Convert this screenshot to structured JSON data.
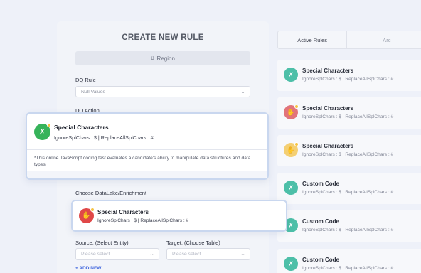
{
  "form": {
    "title": "CREATE NEW RULE",
    "region_label": "Region",
    "dq_rule_label": "DQ Rule",
    "dq_rule_value": "Null Values",
    "dq_action_label": "DQ Action",
    "choose_label": "Choose DataLake/Enrichment",
    "source_label": "Source: (Select Entity)",
    "target_label": "Target: (Choose Table)",
    "source_placeholder": "Please select",
    "target_placeholder": "Please select",
    "add_new_label": "+ ADD NEW"
  },
  "tabs": [
    {
      "label": "Active Rules",
      "active": true
    },
    {
      "label": "Arc",
      "active": false
    }
  ],
  "rules": [
    {
      "name": "Special Characters",
      "params": "IgnoreSplChars : $  |  ReplaceAllSplChars : #",
      "icon": "tools-icon",
      "color": "#4dbfa8",
      "badge": false
    },
    {
      "name": "Special Characters",
      "params": "IgnoreSplChars : $  |  ReplaceAllSplChars : #",
      "icon": "hand-icon",
      "color": "#e2747a",
      "badge": true
    },
    {
      "name": "Special Characters",
      "params": "IgnoreSplChars : $  |  ReplaceAllSplChars : #",
      "icon": "hand-icon",
      "color": "#f4cf72",
      "badge": true
    },
    {
      "name": "Custom Code",
      "params": "IgnoreSplChars : $  |  ReplaceAllSplChars : #",
      "icon": "tools-icon",
      "color": "#4dbfa8",
      "badge": false
    },
    {
      "name": "Custom Code",
      "params": "IgnoreSplChars : $  |  ReplaceAllSplChars : #",
      "icon": "tools-icon",
      "color": "#4dbfa8",
      "badge": false
    },
    {
      "name": "Custom Code",
      "params": "IgnoreSplChars : $  |  ReplaceAllSplChars : #",
      "icon": "tools-icon",
      "color": "#4dbfa8",
      "badge": false
    }
  ],
  "card_special": {
    "name": "Special Characters",
    "params": "IgnoreSplChars : $  |  ReplaceAllSplChars : #",
    "description": "*This online JavaScript coding test evaluates a candidate's ability to manipulate data structures and data types.",
    "icon": "tools-icon",
    "color": "#36b35a"
  },
  "card_special_red": {
    "name": "Special Characters",
    "params": "IgnoreSplChars : $  |  ReplaceAllSplChars : #",
    "icon": "hand-icon",
    "color": "#e04848"
  }
}
